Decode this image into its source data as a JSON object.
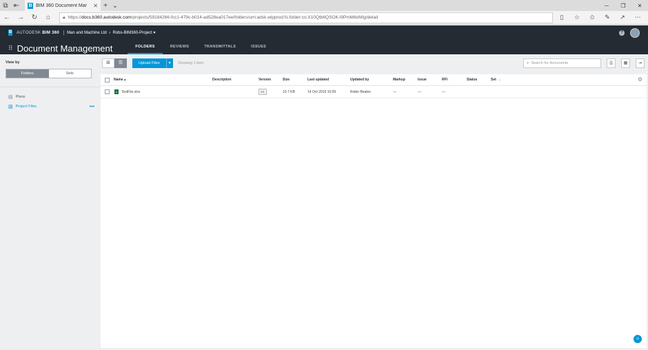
{
  "browser": {
    "tab_title": "BIM 360 Document Mar",
    "url_prefix": "https://",
    "url_host": "docs.b360.autodesk.com",
    "url_path": "/projects/59184266-fcc1-479c-b014-ad528ea017ee/folders/urn:adsk.wipprod:fs.folder:co.X10Qtb6QSOK-l9PmM6xMIg/detail"
  },
  "header": {
    "brand_prefix": "AUTODESK",
    "brand_product": "BIM 360",
    "account": "Man and Machine Ltd",
    "project": "Robs-BIM360-Project ▾",
    "module_title": "Document Management",
    "tabs": [
      {
        "label": "FOLDERS",
        "active": true
      },
      {
        "label": "REVIEWS",
        "active": false
      },
      {
        "label": "TRANSMITTALS",
        "active": false
      },
      {
        "label": "ISSUES",
        "active": false
      }
    ]
  },
  "sidebar": {
    "view_by": "View by",
    "segments": [
      "Folders",
      "Sets"
    ],
    "items": [
      {
        "label": "Plans"
      },
      {
        "label": "Project Files"
      }
    ],
    "more": "•••"
  },
  "toolbar": {
    "upload_label": "Upload Files",
    "showing": "Showing 1 item",
    "search_placeholder": "Search for documents"
  },
  "table": {
    "columns": {
      "name": "Name ▴",
      "description": "Description",
      "version": "Version",
      "size": "Size",
      "last_updated": "Last updated",
      "updated_by": "Updated by",
      "markup": "Markup",
      "issue": "Issue",
      "rfi": "RFI",
      "status": "Status",
      "set": "Set"
    },
    "rows": [
      {
        "name": "TestFile.xlsx",
        "description": "",
        "version": "V1",
        "size": "10.7 KB",
        "last_updated": "14 Oct 2019 10:09",
        "updated_by": "Robin Beales",
        "markup": "—",
        "issue": "—",
        "rfi": "—"
      }
    ]
  }
}
